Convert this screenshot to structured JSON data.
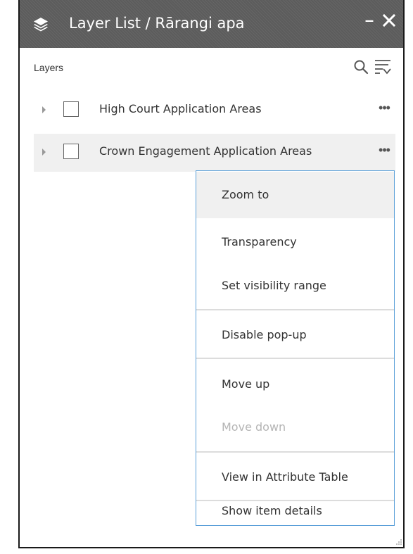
{
  "panel": {
    "title": "Layer List / Rārangi apa",
    "minimize_label": "–",
    "layers_heading": "Layers"
  },
  "layers": [
    {
      "name": "High Court Application Areas",
      "more_label": "•••"
    },
    {
      "name": "Crown Engagement Application Areas",
      "more_label": "•••"
    }
  ],
  "context_menu": {
    "items": [
      {
        "label": "Zoom to"
      },
      {
        "label": "Transparency"
      },
      {
        "label": "Set visibility range"
      },
      {
        "label": "Disable pop-up"
      },
      {
        "label": "Move up"
      },
      {
        "label": "Move down"
      },
      {
        "label": "View in Attribute Table"
      },
      {
        "label": "Show item details"
      }
    ]
  },
  "colors": {
    "titlebar": "#5c5c5c",
    "menu_border": "#5a9fd8",
    "row_highlight": "#f0f0f0",
    "disabled_text": "#b5b5b5"
  },
  "icons": [
    "layers-icon",
    "minimize-icon",
    "close-icon",
    "search-icon",
    "filter-list-icon",
    "expand-arrow-icon",
    "more-options-icon"
  ]
}
